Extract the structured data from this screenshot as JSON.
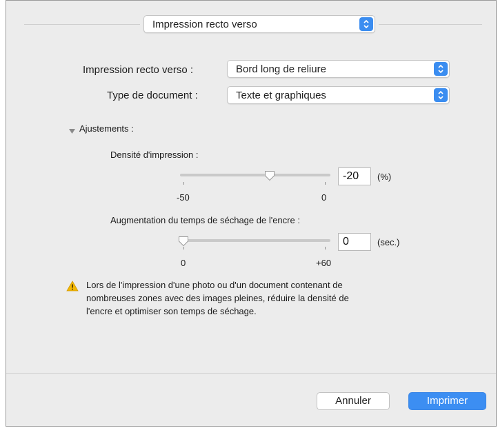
{
  "header": {
    "panel_popup_value": "Impression recto verso"
  },
  "options": {
    "duplex_label": "Impression recto verso :",
    "duplex_value": "Bord long de reliure",
    "doc_type_label": "Type de document :",
    "doc_type_value": "Texte et graphiques"
  },
  "adjustments": {
    "disclosure_label": "Ajustements :",
    "density": {
      "label": "Densité d'impression :",
      "min_label": "-50",
      "max_label": "0",
      "min": -50,
      "max": 0,
      "value": -20,
      "value_text": "-20",
      "unit": "(%)"
    },
    "dry_time": {
      "label": "Augmentation du temps de séchage de l'encre :",
      "min_label": "0",
      "max_label": "+60",
      "min": 0,
      "max": 60,
      "value": 0,
      "value_text": "0",
      "unit": "(sec.)"
    }
  },
  "warning": {
    "icon": "warning-triangle-icon",
    "line1": "Lors de l'impression d'une photo ou d'un document contenant de",
    "line2": "nombreuses zones avec des images pleines, réduire la densité de",
    "line3": "l'encre et optimiser son temps de séchage."
  },
  "footer": {
    "cancel_label": "Annuler",
    "print_label": "Imprimer"
  },
  "colors": {
    "accent": "#3b8df0",
    "warning": "#f2b705",
    "window_bg": "#ececec"
  }
}
